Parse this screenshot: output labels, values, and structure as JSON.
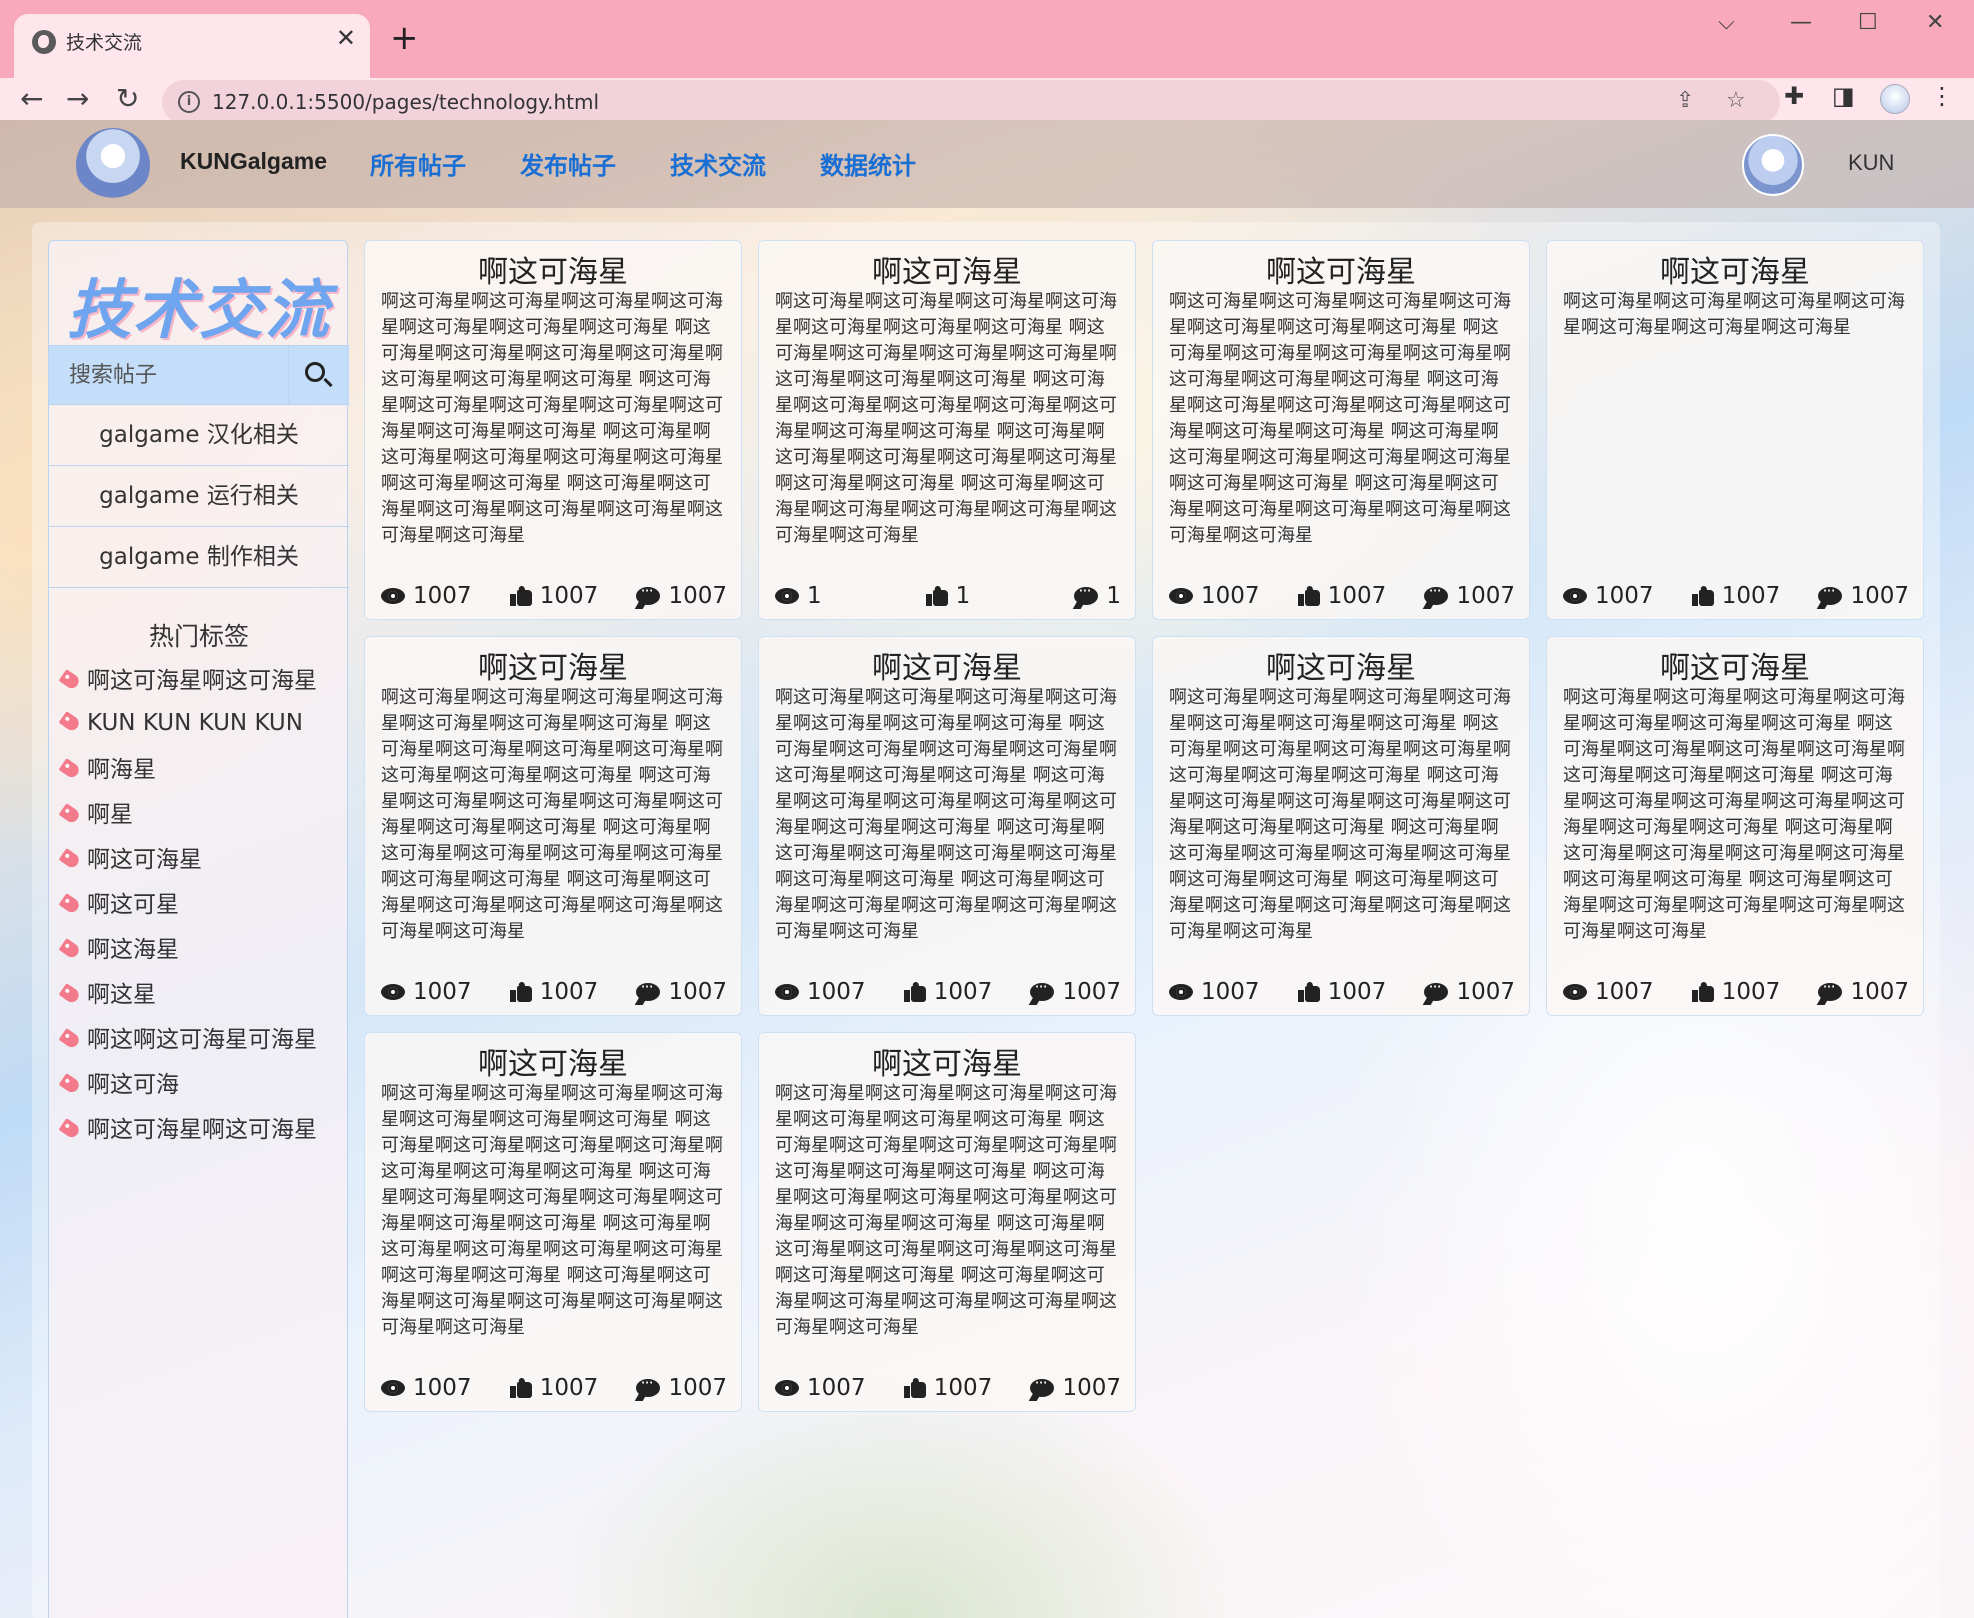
{
  "browser": {
    "tab_title": "技术交流",
    "new_tab": "+",
    "url": "127.0.0.1:5500/pages/technology.html"
  },
  "header": {
    "site_name": "KUNGalgame",
    "nav": [
      "所有帖子",
      "发布帖子",
      "技术交流",
      "数据统计"
    ],
    "username": "KUN"
  },
  "sidebar": {
    "title": "技术交流",
    "search_placeholder": "搜索帖子",
    "categories": [
      "galgame 汉化相关",
      "galgame 运行相关",
      "galgame 制作相关"
    ],
    "hot_tags_title": "热门标签",
    "tags": [
      "啊这可海星啊这可海星",
      "KUN KUN KUN KUN",
      "啊海星",
      "啊星",
      "啊这可海星",
      "啊这可星",
      "啊这海星",
      "啊这星",
      "啊这啊这可海星可海星",
      "啊这可海",
      "啊这可海星啊这可海星"
    ]
  },
  "posts": [
    {
      "title": "啊这可海星",
      "body": "啊这可海星啊这可海星啊这可海星啊这可海星啊这可海星啊这可海星啊这可海星 啊这可海星啊这可海星啊这可海星啊这可海星啊这可海星啊这可海星啊这可海星 啊这可海星啊这可海星啊这可海星啊这可海星啊这可海星啊这可海星啊这可海星 啊这可海星啊这可海星啊这可海星啊这可海星啊这可海星啊这可海星啊这可海星 啊这可海星啊这可海星啊这可海星啊这可海星啊这可海星啊这可海星啊这可海星",
      "views": "1007",
      "likes": "1007",
      "comments": "1007"
    },
    {
      "title": "啊这可海星",
      "body": "啊这可海星啊这可海星啊这可海星啊这可海星啊这可海星啊这可海星啊这可海星 啊这可海星啊这可海星啊这可海星啊这可海星啊这可海星啊这可海星啊这可海星 啊这可海星啊这可海星啊这可海星啊这可海星啊这可海星啊这可海星啊这可海星 啊这可海星啊这可海星啊这可海星啊这可海星啊这可海星啊这可海星啊这可海星 啊这可海星啊这可海星啊这可海星啊这可海星啊这可海星啊这可海星啊这可海星",
      "views": "1",
      "likes": "1",
      "comments": "1"
    },
    {
      "title": "啊这可海星",
      "body": "啊这可海星啊这可海星啊这可海星啊这可海星啊这可海星啊这可海星啊这可海星 啊这可海星啊这可海星啊这可海星啊这可海星啊这可海星啊这可海星啊这可海星 啊这可海星啊这可海星啊这可海星啊这可海星啊这可海星啊这可海星啊这可海星 啊这可海星啊这可海星啊这可海星啊这可海星啊这可海星啊这可海星啊这可海星 啊这可海星啊这可海星啊这可海星啊这可海星啊这可海星啊这可海星啊这可海星",
      "views": "1007",
      "likes": "1007",
      "comments": "1007"
    },
    {
      "title": "啊这可海星",
      "body": "啊这可海星啊这可海星啊这可海星啊这可海星啊这可海星啊这可海星啊这可海星",
      "views": "1007",
      "likes": "1007",
      "comments": "1007"
    },
    {
      "title": "啊这可海星",
      "body": "啊这可海星啊这可海星啊这可海星啊这可海星啊这可海星啊这可海星啊这可海星 啊这可海星啊这可海星啊这可海星啊这可海星啊这可海星啊这可海星啊这可海星 啊这可海星啊这可海星啊这可海星啊这可海星啊这可海星啊这可海星啊这可海星 啊这可海星啊这可海星啊这可海星啊这可海星啊这可海星啊这可海星啊这可海星 啊这可海星啊这可海星啊这可海星啊这可海星啊这可海星啊这可海星啊这可海星",
      "views": "1007",
      "likes": "1007",
      "comments": "1007"
    },
    {
      "title": "啊这可海星",
      "body": "啊这可海星啊这可海星啊这可海星啊这可海星啊这可海星啊这可海星啊这可海星 啊这可海星啊这可海星啊这可海星啊这可海星啊这可海星啊这可海星啊这可海星 啊这可海星啊这可海星啊这可海星啊这可海星啊这可海星啊这可海星啊这可海星 啊这可海星啊这可海星啊这可海星啊这可海星啊这可海星啊这可海星啊这可海星 啊这可海星啊这可海星啊这可海星啊这可海星啊这可海星啊这可海星啊这可海星",
      "views": "1007",
      "likes": "1007",
      "comments": "1007"
    },
    {
      "title": "啊这可海星",
      "body": "啊这可海星啊这可海星啊这可海星啊这可海星啊这可海星啊这可海星啊这可海星 啊这可海星啊这可海星啊这可海星啊这可海星啊这可海星啊这可海星啊这可海星 啊这可海星啊这可海星啊这可海星啊这可海星啊这可海星啊这可海星啊这可海星 啊这可海星啊这可海星啊这可海星啊这可海星啊这可海星啊这可海星啊这可海星 啊这可海星啊这可海星啊这可海星啊这可海星啊这可海星啊这可海星啊这可海星",
      "views": "1007",
      "likes": "1007",
      "comments": "1007"
    },
    {
      "title": "啊这可海星",
      "body": "啊这可海星啊这可海星啊这可海星啊这可海星啊这可海星啊这可海星啊这可海星 啊这可海星啊这可海星啊这可海星啊这可海星啊这可海星啊这可海星啊这可海星 啊这可海星啊这可海星啊这可海星啊这可海星啊这可海星啊这可海星啊这可海星 啊这可海星啊这可海星啊这可海星啊这可海星啊这可海星啊这可海星啊这可海星 啊这可海星啊这可海星啊这可海星啊这可海星啊这可海星啊这可海星啊这可海星",
      "views": "1007",
      "likes": "1007",
      "comments": "1007"
    },
    {
      "title": "啊这可海星",
      "body": "啊这可海星啊这可海星啊这可海星啊这可海星啊这可海星啊这可海星啊这可海星 啊这可海星啊这可海星啊这可海星啊这可海星啊这可海星啊这可海星啊这可海星 啊这可海星啊这可海星啊这可海星啊这可海星啊这可海星啊这可海星啊这可海星 啊这可海星啊这可海星啊这可海星啊这可海星啊这可海星啊这可海星啊这可海星 啊这可海星啊这可海星啊这可海星啊这可海星啊这可海星啊这可海星啊这可海星",
      "views": "1007",
      "likes": "1007",
      "comments": "1007"
    },
    {
      "title": "啊这可海星",
      "body": "啊这可海星啊这可海星啊这可海星啊这可海星啊这可海星啊这可海星啊这可海星 啊这可海星啊这可海星啊这可海星啊这可海星啊这可海星啊这可海星啊这可海星 啊这可海星啊这可海星啊这可海星啊这可海星啊这可海星啊这可海星啊这可海星 啊这可海星啊这可海星啊这可海星啊这可海星啊这可海星啊这可海星啊这可海星 啊这可海星啊这可海星啊这可海星啊这可海星啊这可海星啊这可海星啊这可海星",
      "views": "1007",
      "likes": "1007",
      "comments": "1007"
    }
  ],
  "colors": {
    "nav_link": "#1a6fd4",
    "accent_title": "#6fa4ee",
    "tag_icon": "#f27a8a",
    "tab_strip": "#f9a9bc"
  }
}
